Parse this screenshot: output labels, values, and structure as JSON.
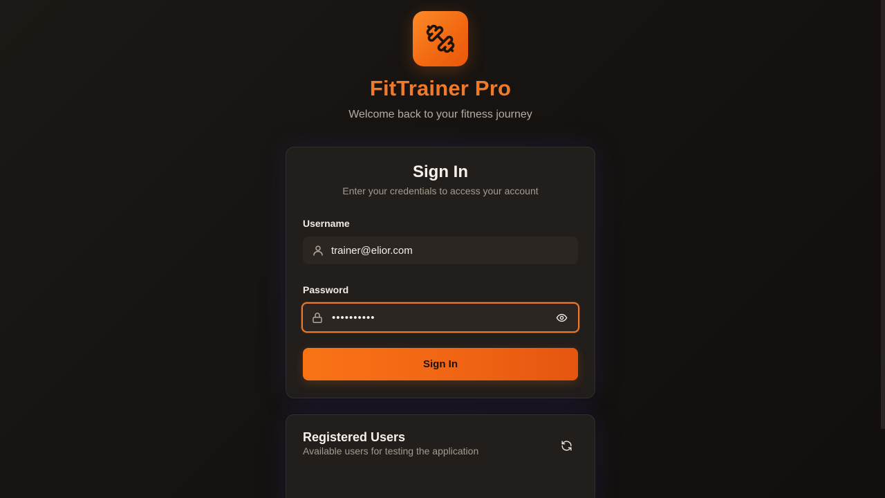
{
  "brand": {
    "logo_icon": "dumbbell-icon",
    "name": "FitTrainer Pro",
    "tagline": "Welcome back to your fitness journey"
  },
  "signin": {
    "title": "Sign In",
    "subtitle": "Enter your credentials to access your account",
    "username_label": "Username",
    "username_value": "trainer@elior.com",
    "username_icon": "user-icon",
    "password_label": "Password",
    "password_value": "••••••••••",
    "password_icon": "lock-icon",
    "toggle_icon": "eye-icon",
    "submit_label": "Sign In"
  },
  "users": {
    "title": "Registered Users",
    "subtitle": "Available users for testing the application",
    "refresh_icon": "refresh-icon"
  },
  "colors": {
    "accent": "#f97316",
    "brand_text": "#f07a2c",
    "background": "#161210",
    "card": "#221e1b"
  }
}
